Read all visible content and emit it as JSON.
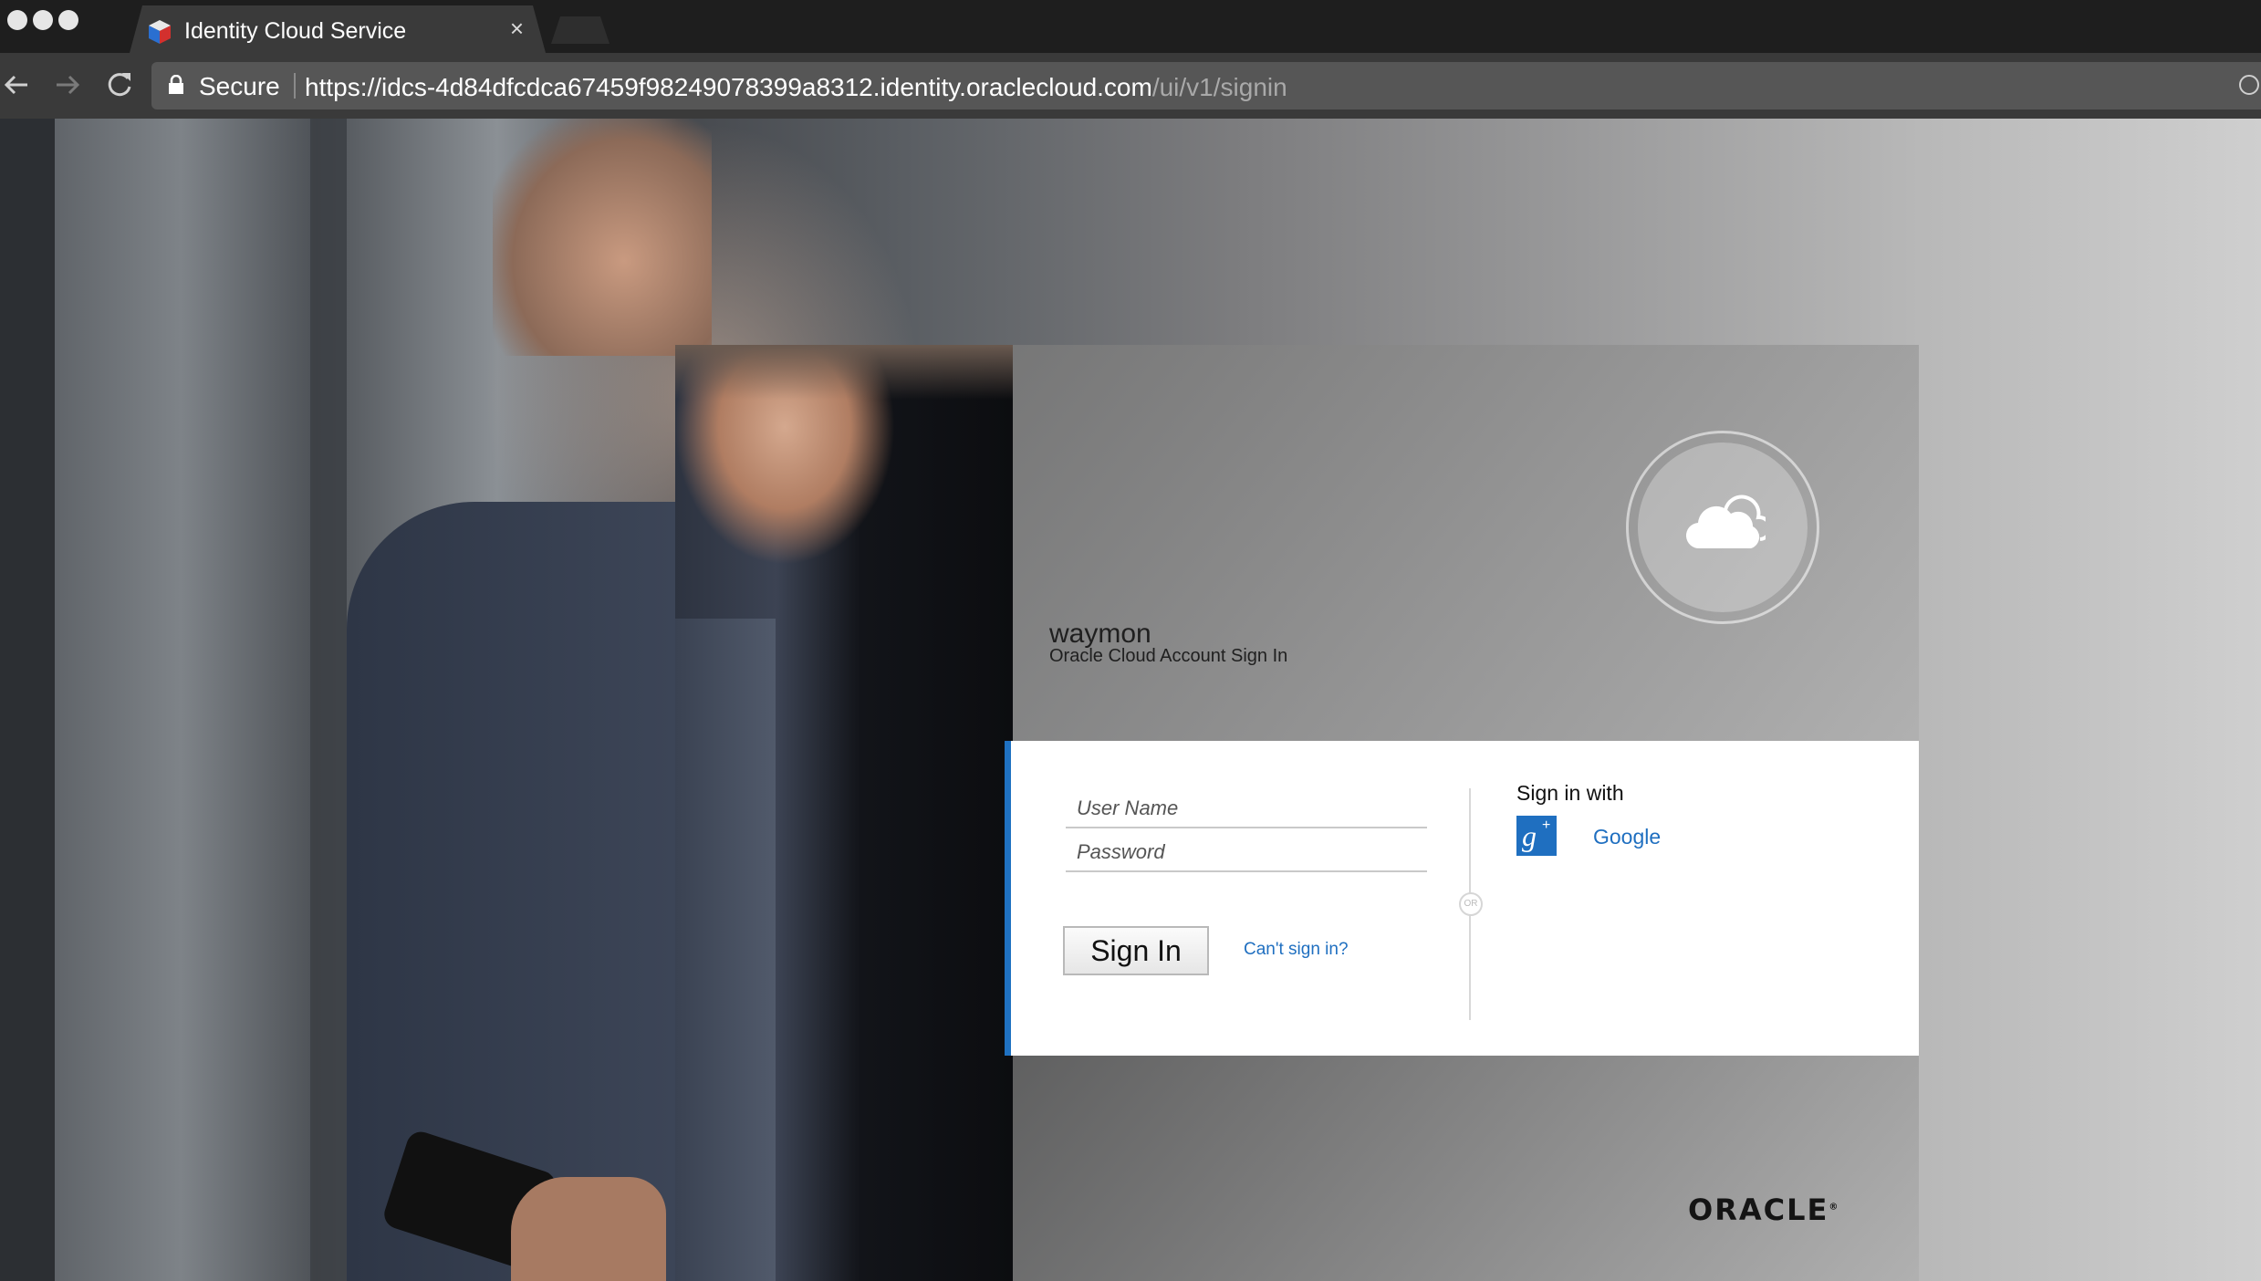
{
  "browser": {
    "tab_title": "Identity Cloud Service",
    "tab_close": "×",
    "secure_label": "Secure",
    "url_scheme": "https://",
    "url_host": "idcs-4d84dfcdca67459f98249078399a8312.identity.oraclecloud.com",
    "url_path": "/ui/v1/signin"
  },
  "signin": {
    "tenant_name": "waymon",
    "subtitle": "Oracle Cloud Account Sign In",
    "username_placeholder": "User Name",
    "password_placeholder": "Password",
    "signin_button": "Sign In",
    "cant_signin_link": "Can't sign in?",
    "or_label": "OR",
    "sign_in_with": "Sign in with",
    "google_label": "Google",
    "gplus_glyph": "g",
    "gplus_plus": "+",
    "oracle_logo": "ORACLE",
    "oracle_trademark": "®"
  },
  "colors": {
    "accent_blue": "#1f71c1",
    "chrome_dark": "#1e1e1e",
    "omnibox": "#565656"
  }
}
